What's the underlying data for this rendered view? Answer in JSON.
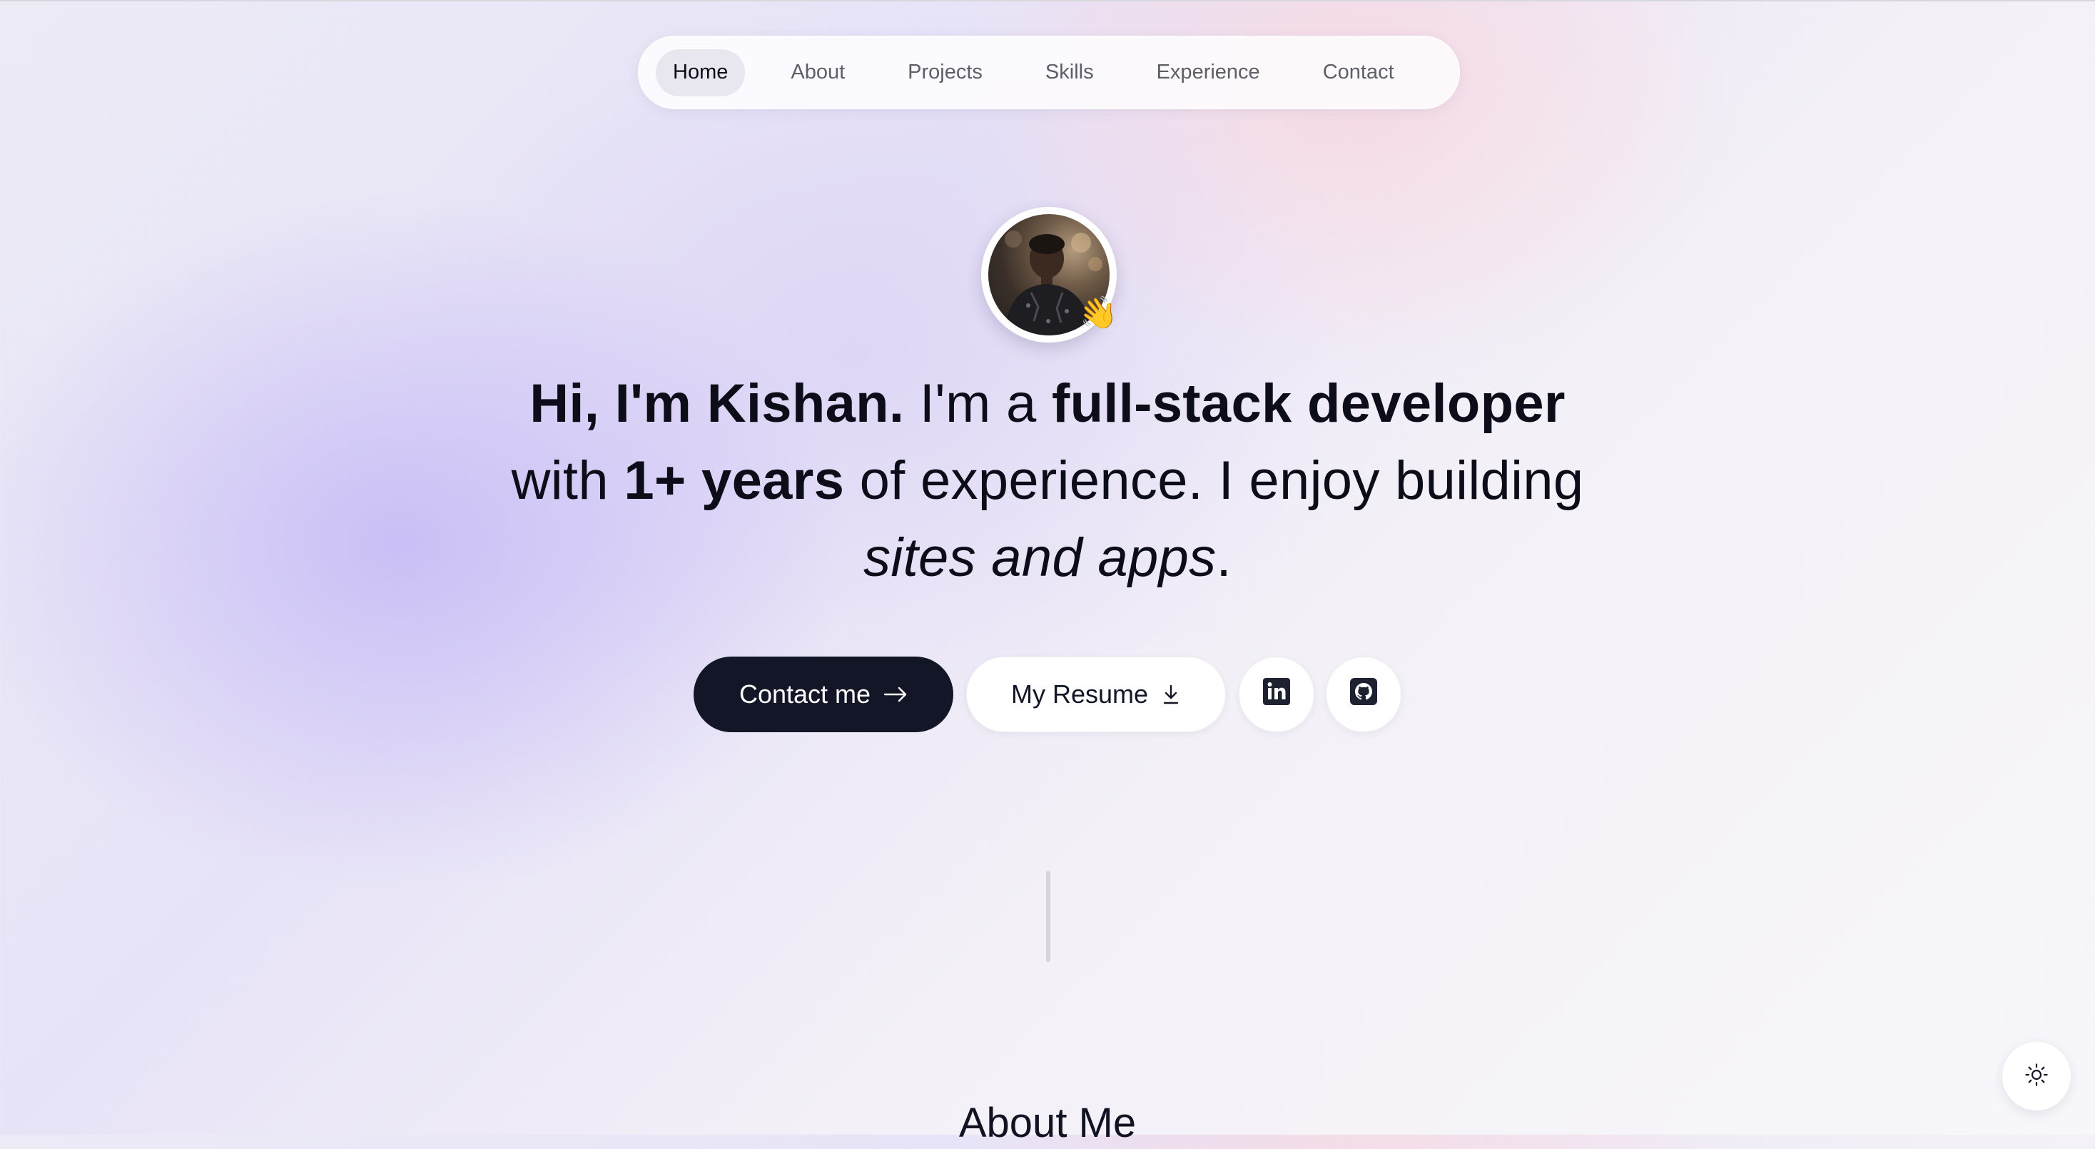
{
  "nav": {
    "items": [
      {
        "label": "Home",
        "active": true
      },
      {
        "label": "About",
        "active": false
      },
      {
        "label": "Projects",
        "active": false
      },
      {
        "label": "Skills",
        "active": false
      },
      {
        "label": "Experience",
        "active": false
      },
      {
        "label": "Contact",
        "active": false
      }
    ]
  },
  "hero": {
    "avatar_emoji": "👋",
    "headline": {
      "greeting": "Hi, I'm Kishan.",
      "part1": " I'm a ",
      "role": "full-stack developer",
      "part2": " with ",
      "years": "1+ years",
      "part3": " of experience. I enjoy building ",
      "craft": "sites and apps",
      "end": "."
    },
    "buttons": {
      "contact_label": "Contact me",
      "resume_label": "My Resume"
    },
    "icons": {
      "contact": "arrow-right-icon",
      "resume": "download-icon",
      "linkedin": "linkedin-icon",
      "github": "github-icon"
    }
  },
  "about": {
    "heading": "About Me"
  },
  "theme_toggle": {
    "icon": "sun-icon"
  },
  "colors": {
    "primary_button": "#121626",
    "text": "#0d0d1a",
    "nav_active_bg": "#e8e6ee"
  }
}
